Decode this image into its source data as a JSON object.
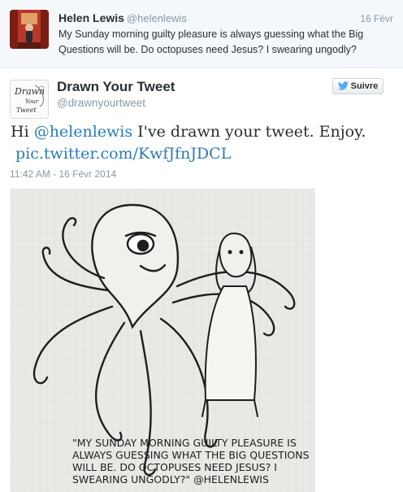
{
  "parent_tweet": {
    "author_name": "Helen Lewis",
    "author_handle": "@helenlewis",
    "date": "16 Févr",
    "text": "My Sunday morning guilty pleasure is always guessing what the Big Questions will be. Do octopuses need Jesus? I swearing ungodly?"
  },
  "main_tweet": {
    "author_name": "Drawn Your Tweet",
    "author_handle": "@drawnyourtweet",
    "follow_label": "Suivre",
    "avatar_text": [
      "Drawn",
      "Your",
      "Tweet"
    ],
    "text_prefix": "Hi ",
    "mention": "@helenlewis",
    "text_suffix": " I've drawn your tweet. Enjoy.",
    "link": "pic.twitter.com/KwfJfnJDCL",
    "timestamp": "11:42 AM - 16 Févr 2014"
  },
  "photo": {
    "caption_lines": [
      "\"MY SUNDAY MORNING GUILTY PLEASURE IS",
      "ALWAYS GUESSING WHAT THE BIG QUESTIONS",
      "WILL BE. DO OCTOPUSES NEED JESUS? I",
      "SWEARING UNGODLY?\" @HELENLEWIS"
    ]
  },
  "colors": {
    "link": "#2b7bb9",
    "muted": "#8899a6",
    "twitter_blue": "#55acee",
    "parent_bg": "#f5f8fa"
  }
}
